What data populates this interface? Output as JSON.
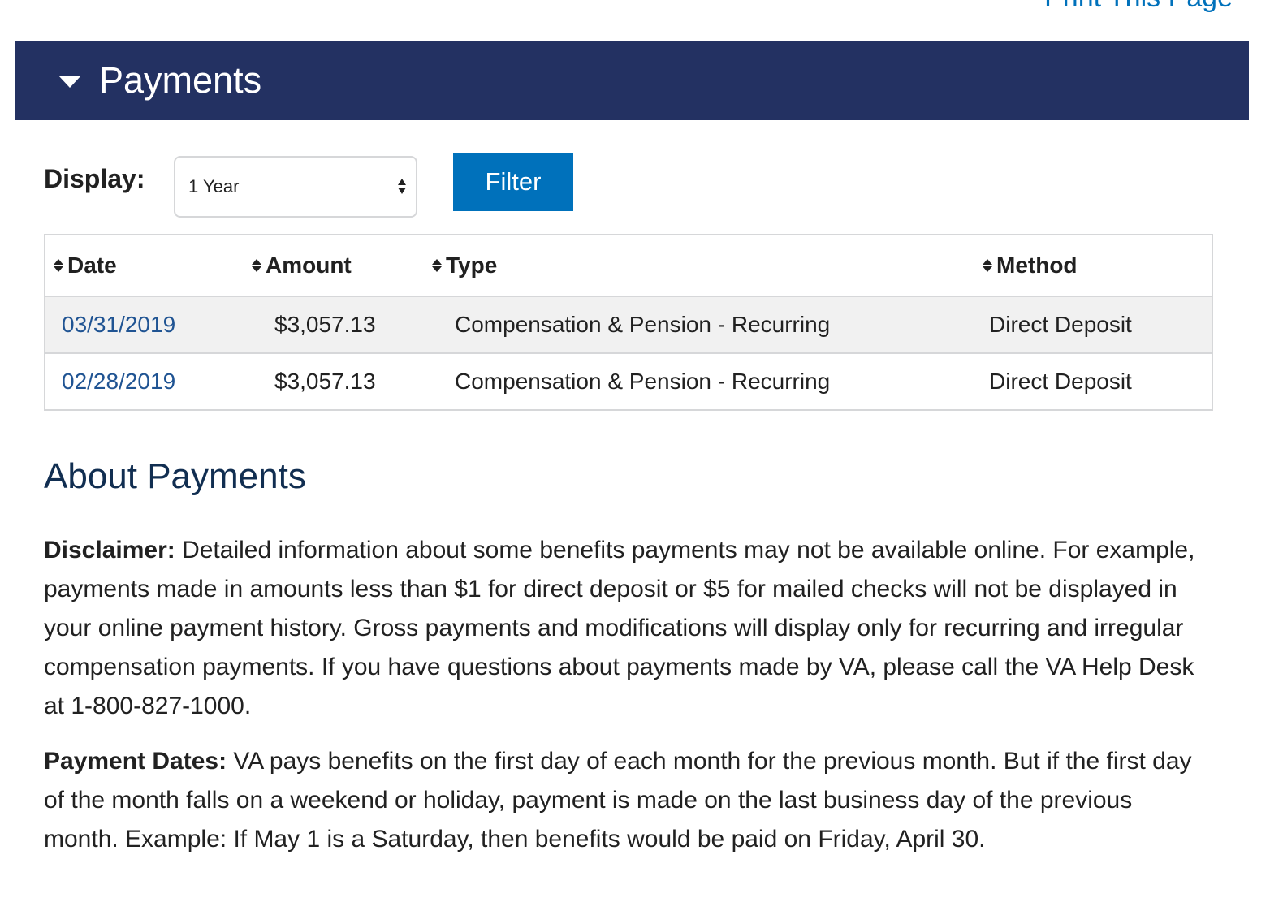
{
  "header": {
    "print_link": "Print This Page",
    "title": "Payments"
  },
  "filter": {
    "display_label": "Display:",
    "selected_range": "1 Year",
    "button_label": "Filter"
  },
  "table": {
    "columns": [
      "Date",
      "Amount",
      "Type",
      "Method"
    ],
    "rows": [
      {
        "date": "03/31/2019",
        "amount": "$3,057.13",
        "type": "Compensation & Pension - Recurring",
        "method": "Direct Deposit"
      },
      {
        "date": "02/28/2019",
        "amount": "$3,057.13",
        "type": "Compensation & Pension - Recurring",
        "method": "Direct Deposit"
      }
    ]
  },
  "about": {
    "heading": "About Payments",
    "disclaimer_label": "Disclaimer:",
    "disclaimer_text": " Detailed information about some benefits payments may not be available online. For example, payments made in amounts less than $1 for direct deposit or $5 for mailed checks will not be displayed in your online payment history. Gross payments and modifications will display only for recurring and irregular compensation payments. If you have questions about payments made by VA, please call the VA Help Desk at 1-800-827-1000.",
    "payment_dates_label": "Payment Dates:",
    "payment_dates_text": " VA pays benefits on the first day of each month for the previous month. But if the first day of the month falls on a weekend or holiday, payment is made on the last business day of the previous month. Example: If May 1 is a Saturday, then benefits would be paid on Friday, April 30."
  },
  "colors": {
    "header_bg": "#233162",
    "accent_blue": "#0071bb",
    "link_blue": "#205493",
    "heading_navy": "#112e51"
  }
}
